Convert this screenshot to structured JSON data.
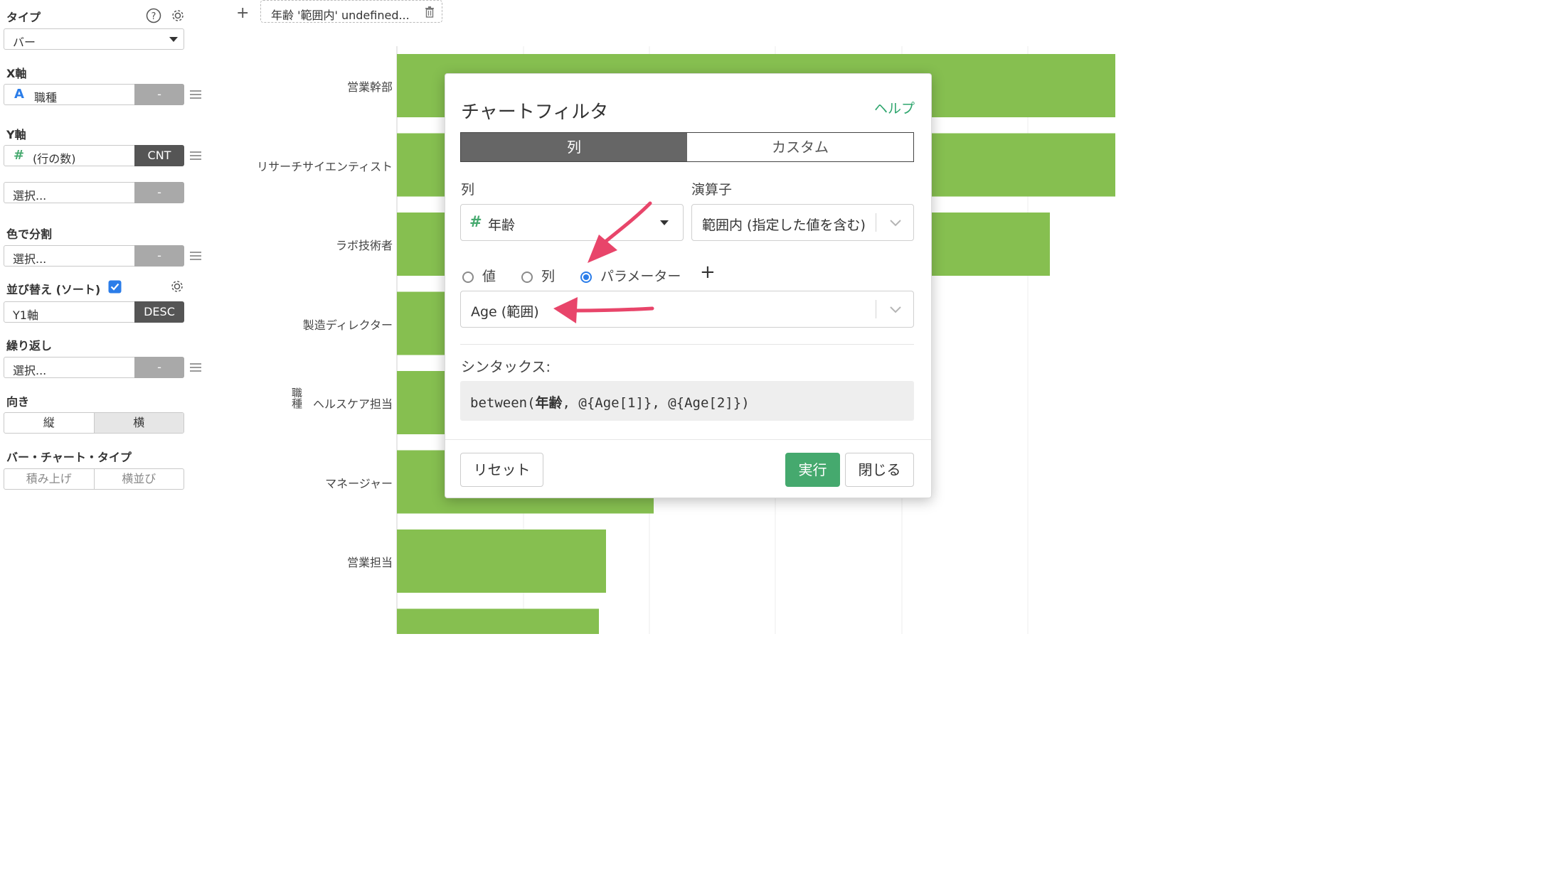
{
  "sidebar": {
    "type": {
      "title": "タイプ",
      "value": "バー"
    },
    "x_axis": {
      "title": "X軸",
      "icon_glyph": "A",
      "value": "職種",
      "tag": "-"
    },
    "y_axis": {
      "title": "Y軸",
      "icon_glyph": "#",
      "value": "(行の数)",
      "tag": "CNT"
    },
    "y_axis_extra": {
      "value": "選択...",
      "tag": "-"
    },
    "color_split": {
      "title": "色で分割",
      "value": "選択...",
      "tag": "-"
    },
    "sort": {
      "title": "並び替え (ソート)",
      "checked": true,
      "value": "Y1軸",
      "tag": "DESC"
    },
    "repeat": {
      "title": "繰り返し",
      "value": "選択...",
      "tag": "-"
    },
    "orientation": {
      "title": "向き",
      "options": [
        "縦",
        "横"
      ],
      "selected": "横"
    },
    "bar_type": {
      "title": "バー・チャート・タイプ",
      "options": [
        "積み上げ",
        "横並び"
      ]
    }
  },
  "topbar": {
    "add_label": "+",
    "filter_chip": "年齢 '範囲内' undefined..."
  },
  "chart_data": {
    "type": "bar",
    "orientation": "horizontal",
    "ylabel": "職種",
    "categories": [
      "営業幹部",
      "リサーチサイエンティスト",
      "ラボ技術者",
      "製造ディレクター",
      "ヘルスケア担当",
      "マネージャー",
      "営業担当",
      ""
    ],
    "bar_color": "#86bf50",
    "grid": true
  },
  "modal": {
    "title": "チャートフィルタ",
    "help": "ヘルプ",
    "tabs": [
      "列",
      "カスタム"
    ],
    "active_tab": "列",
    "column_label": "列",
    "column_icon": "#",
    "column_value": "年齢",
    "operator_label": "演算子",
    "operator_value": "範囲内 (指定した値を含む)",
    "radio_options": [
      "値",
      "列",
      "パラメーター"
    ],
    "radio_selected": "パラメーター",
    "add_param": "+",
    "parameter_value": "Age (範囲)",
    "syntax_label": "シンタックス:",
    "syntax": "between(年齢, @{Age[1]}, @{Age[2]})",
    "syntax_bold": "年齢",
    "buttons": {
      "reset": "リセット",
      "run": "実行",
      "close": "閉じる"
    },
    "accent_color": "#45a96e",
    "annotation_arrow_color": "#e8456a"
  }
}
